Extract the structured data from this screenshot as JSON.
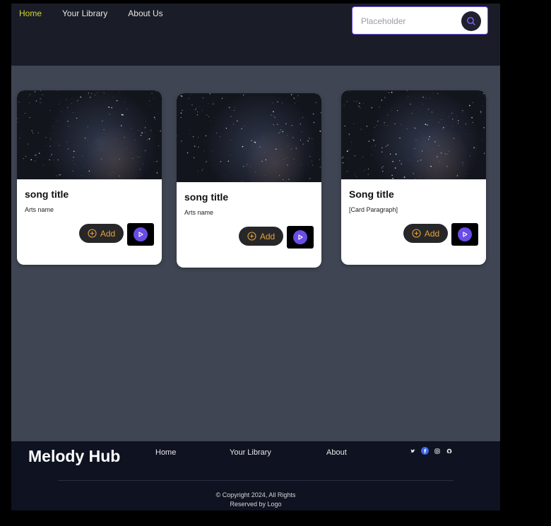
{
  "header": {
    "nav": [
      {
        "label": "Home",
        "active": true
      },
      {
        "label": "Your Library",
        "active": false
      },
      {
        "label": "About Us",
        "active": false
      }
    ],
    "search": {
      "placeholder": "Placeholder",
      "value": "",
      "icon": "search-icon"
    }
  },
  "cards": [
    {
      "title": "song title",
      "subtitle": "Arts name",
      "add_label": "Add",
      "add_icon": "plus-circle-icon",
      "play_icon": "play-icon"
    },
    {
      "title": "song title",
      "subtitle": "Arts name",
      "add_label": "Add",
      "add_icon": "plus-circle-icon",
      "play_icon": "play-icon"
    },
    {
      "title": "Song title",
      "subtitle": "[Card Paragraph]",
      "add_label": "Add",
      "add_icon": "plus-circle-icon",
      "play_icon": "play-icon"
    }
  ],
  "footer": {
    "brand": "Melody Hub",
    "nav": [
      "Home",
      "Your Library",
      "About"
    ],
    "socials": [
      "twitter-icon",
      "facebook-icon",
      "instagram-icon",
      "github-icon"
    ],
    "copyright_line1": "© Copyright 2024, All Rights",
    "copyright_line2": "Reserved by Logo"
  },
  "colors": {
    "accent": "#6a4de6",
    "nav_active": "#d4d82a",
    "add_text": "#e3a23a",
    "page_bg": "#3f4553",
    "header_bg": "#1a1d27",
    "footer_bg": "#0f1220"
  }
}
